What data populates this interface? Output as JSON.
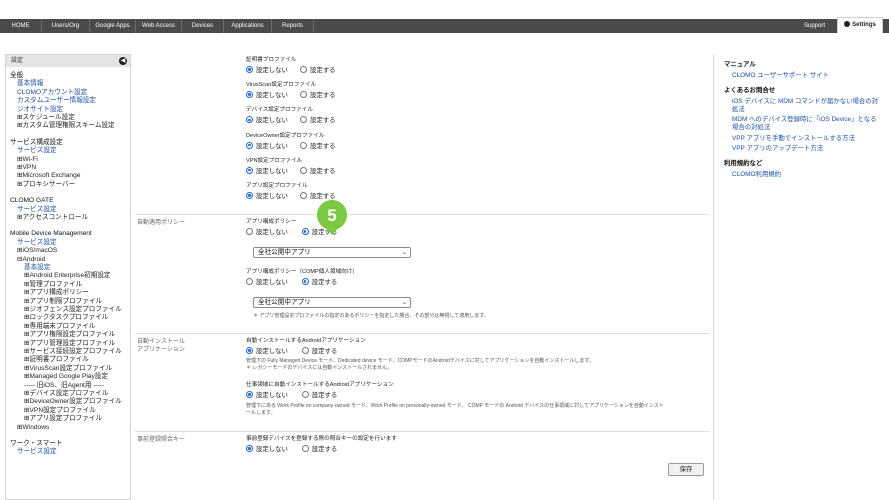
{
  "nav": {
    "items": [
      "HOME",
      "Users/Org",
      "Google Apps",
      "Web Access",
      "Devices",
      "Applications",
      "Reports"
    ],
    "support": "Support",
    "settings": "Settings"
  },
  "sidebar": {
    "title": "設定",
    "lines": [
      {
        "text": "全般",
        "kind": "h",
        "indent": 0
      },
      {
        "text": "基本情報",
        "kind": "link",
        "indent": 1
      },
      {
        "text": "CLOMOアカウント設定",
        "kind": "link",
        "indent": 1
      },
      {
        "text": "カスタムユーザー情報設定",
        "kind": "link",
        "indent": 1
      },
      {
        "text": "ジオサイト設定",
        "kind": "link",
        "indent": 1
      },
      {
        "text": "⊞スケジュール設定",
        "kind": "t",
        "indent": 1
      },
      {
        "text": "⊞カスタム管理権限スキーム設定",
        "kind": "t",
        "indent": 1
      },
      {
        "text": "",
        "kind": "gap",
        "indent": 0
      },
      {
        "text": "サービス構成設定",
        "kind": "h",
        "indent": 0
      },
      {
        "text": "サービス設定",
        "kind": "link",
        "indent": 1
      },
      {
        "text": "⊞Wi-Fi",
        "kind": "t",
        "indent": 1
      },
      {
        "text": "⊞VPN",
        "kind": "t",
        "indent": 1
      },
      {
        "text": "⊞Microsoft Exchange",
        "kind": "t",
        "indent": 1
      },
      {
        "text": "⊞プロキシサーバー",
        "kind": "t",
        "indent": 1
      },
      {
        "text": "",
        "kind": "gap",
        "indent": 0
      },
      {
        "text": "CLOMO GATE",
        "kind": "h",
        "indent": 0
      },
      {
        "text": "サービス設定",
        "kind": "link",
        "indent": 1
      },
      {
        "text": "⊞アクセスコントロール",
        "kind": "t",
        "indent": 1
      },
      {
        "text": "",
        "kind": "gap",
        "indent": 0
      },
      {
        "text": "Mobile Device Management",
        "kind": "h",
        "indent": 0
      },
      {
        "text": "サービス設定",
        "kind": "link",
        "indent": 1
      },
      {
        "text": "⊞iOS/macOS",
        "kind": "t",
        "indent": 1
      },
      {
        "text": "⊟Android",
        "kind": "t",
        "indent": 1
      },
      {
        "text": "基本設定",
        "kind": "link",
        "indent": 2
      },
      {
        "text": "⊞Android Enterprise初期設定",
        "kind": "t",
        "indent": 2
      },
      {
        "text": "⊞管理プロファイル",
        "kind": "t",
        "indent": 2
      },
      {
        "text": "⊞アプリ構成ポリシー",
        "kind": "t",
        "indent": 2
      },
      {
        "text": "⊞アプリ制限プロファイル",
        "kind": "t",
        "indent": 2
      },
      {
        "text": "⊞ジオフェンス設定プロファイル",
        "kind": "t",
        "indent": 2
      },
      {
        "text": "⊞ロックタスクプロファイル",
        "kind": "t",
        "indent": 2
      },
      {
        "text": "⊞専用端末プロファイル",
        "kind": "t",
        "indent": 2
      },
      {
        "text": "⊞アプリ権限設定プロファイル",
        "kind": "t",
        "indent": 2
      },
      {
        "text": "⊞アプリ管理設定プロファイル",
        "kind": "t",
        "indent": 2
      },
      {
        "text": "⊞サービス接続設定プロファイル",
        "kind": "t",
        "indent": 2
      },
      {
        "text": "⊞証明書プロファイル",
        "kind": "t",
        "indent": 2
      },
      {
        "text": "⊞VirusScan設定プロファイル",
        "kind": "t",
        "indent": 2
      },
      {
        "text": "⊞Managed Google Play設定",
        "kind": "t",
        "indent": 2
      },
      {
        "text": "----- 旧iOS、旧Agent用 -----",
        "kind": "t",
        "indent": 2
      },
      {
        "text": "⊞デバイス設定プロファイル",
        "kind": "t",
        "indent": 2
      },
      {
        "text": "⊞DeviceOwner設定プロファイル",
        "kind": "t",
        "indent": 2
      },
      {
        "text": "⊞VPN設定プロファイル",
        "kind": "t",
        "indent": 2
      },
      {
        "text": "⊞アプリ設定プロファイル",
        "kind": "t",
        "indent": 2
      },
      {
        "text": "⊞Windows",
        "kind": "t",
        "indent": 1
      },
      {
        "text": "",
        "kind": "gap",
        "indent": 0
      },
      {
        "text": "ワーク・スマート",
        "kind": "h",
        "indent": 0
      },
      {
        "text": "サービス設定",
        "kind": "link",
        "indent": 1
      }
    ]
  },
  "main": {
    "profiles": [
      {
        "label": "証明書プロファイル",
        "selected": 0
      },
      {
        "label": "VirusScan設定プロファイル",
        "selected": 0
      },
      {
        "label": "デバイス設定プロファイル",
        "selected": 0
      },
      {
        "label": "DeviceOwner設定プロファイル",
        "selected": 0
      },
      {
        "label": "VPN設定プロファイル",
        "selected": 0
      },
      {
        "label": "アプリ設定プロファイル",
        "selected": 0
      }
    ],
    "opt_off": "設定しない",
    "opt_on": "設定する",
    "auto_policy": {
      "section": "自動適用ポリシー",
      "app_policy_label": "アプリ構成ポリシー",
      "app_policy_select": "全社公開中アプリ",
      "cope_label": "アプリ構成ポリシー（COMP個人領域向け）",
      "cope_select": "全社公開中アプリ",
      "note": "＊ アプリ管理設定プロファイルの指定のあるポリシーを指定した場合、その部分は無視して適用します。"
    },
    "auto_install": {
      "section_line1": "自動インストール",
      "section_line2": "アプリケーション",
      "label1": "自動インストールするAndroidアプリケーション",
      "note1": "管理下の Fully Managed Device モード、Dedicated device モード、COMPモードのAndroidデバイスに対してアプリケーションを自動インストールします。",
      "note1b": "＊ レガシーモードのデバイスには自動インストールされません。",
      "label2": "仕事領域に自動インストールするAndroidアプリケーション",
      "note2a": "管理下にある Work Profile on company-owned モード、Work Profile on personally-owned モード、 COMP モードの Android デバイスの仕事領域に対してアプリケーションを自動インスト",
      "note2b": "ールします。"
    },
    "prereg": {
      "section": "事前登録照合キー",
      "label": "事前登録デバイスを登録する際の照合キーの設定を行います"
    },
    "save": "保存",
    "callout_number": "5"
  },
  "right": {
    "manual_title": "マニュアル",
    "manual_link": "CLOMO ユーザーサポート サイト",
    "faq_title": "よくあるお問合せ",
    "faq_links": [
      "iOS デバイスに MDM コマンドが届かない場合の対",
      "処法",
      "MDM へのデバイス登録時に「iOS Device」となる",
      "場合の対処法",
      "VPP アプリを手動でインストールする方法",
      "VPP アプリのアップデート方法"
    ],
    "terms_title": "利用規約など",
    "terms_link": "CLOMO利用規約"
  },
  "colors": {
    "nav_bg": "#4a4a4a",
    "link": "#1a4fa0",
    "callout": "#7ac943",
    "radio_on": "#1f66d1"
  }
}
